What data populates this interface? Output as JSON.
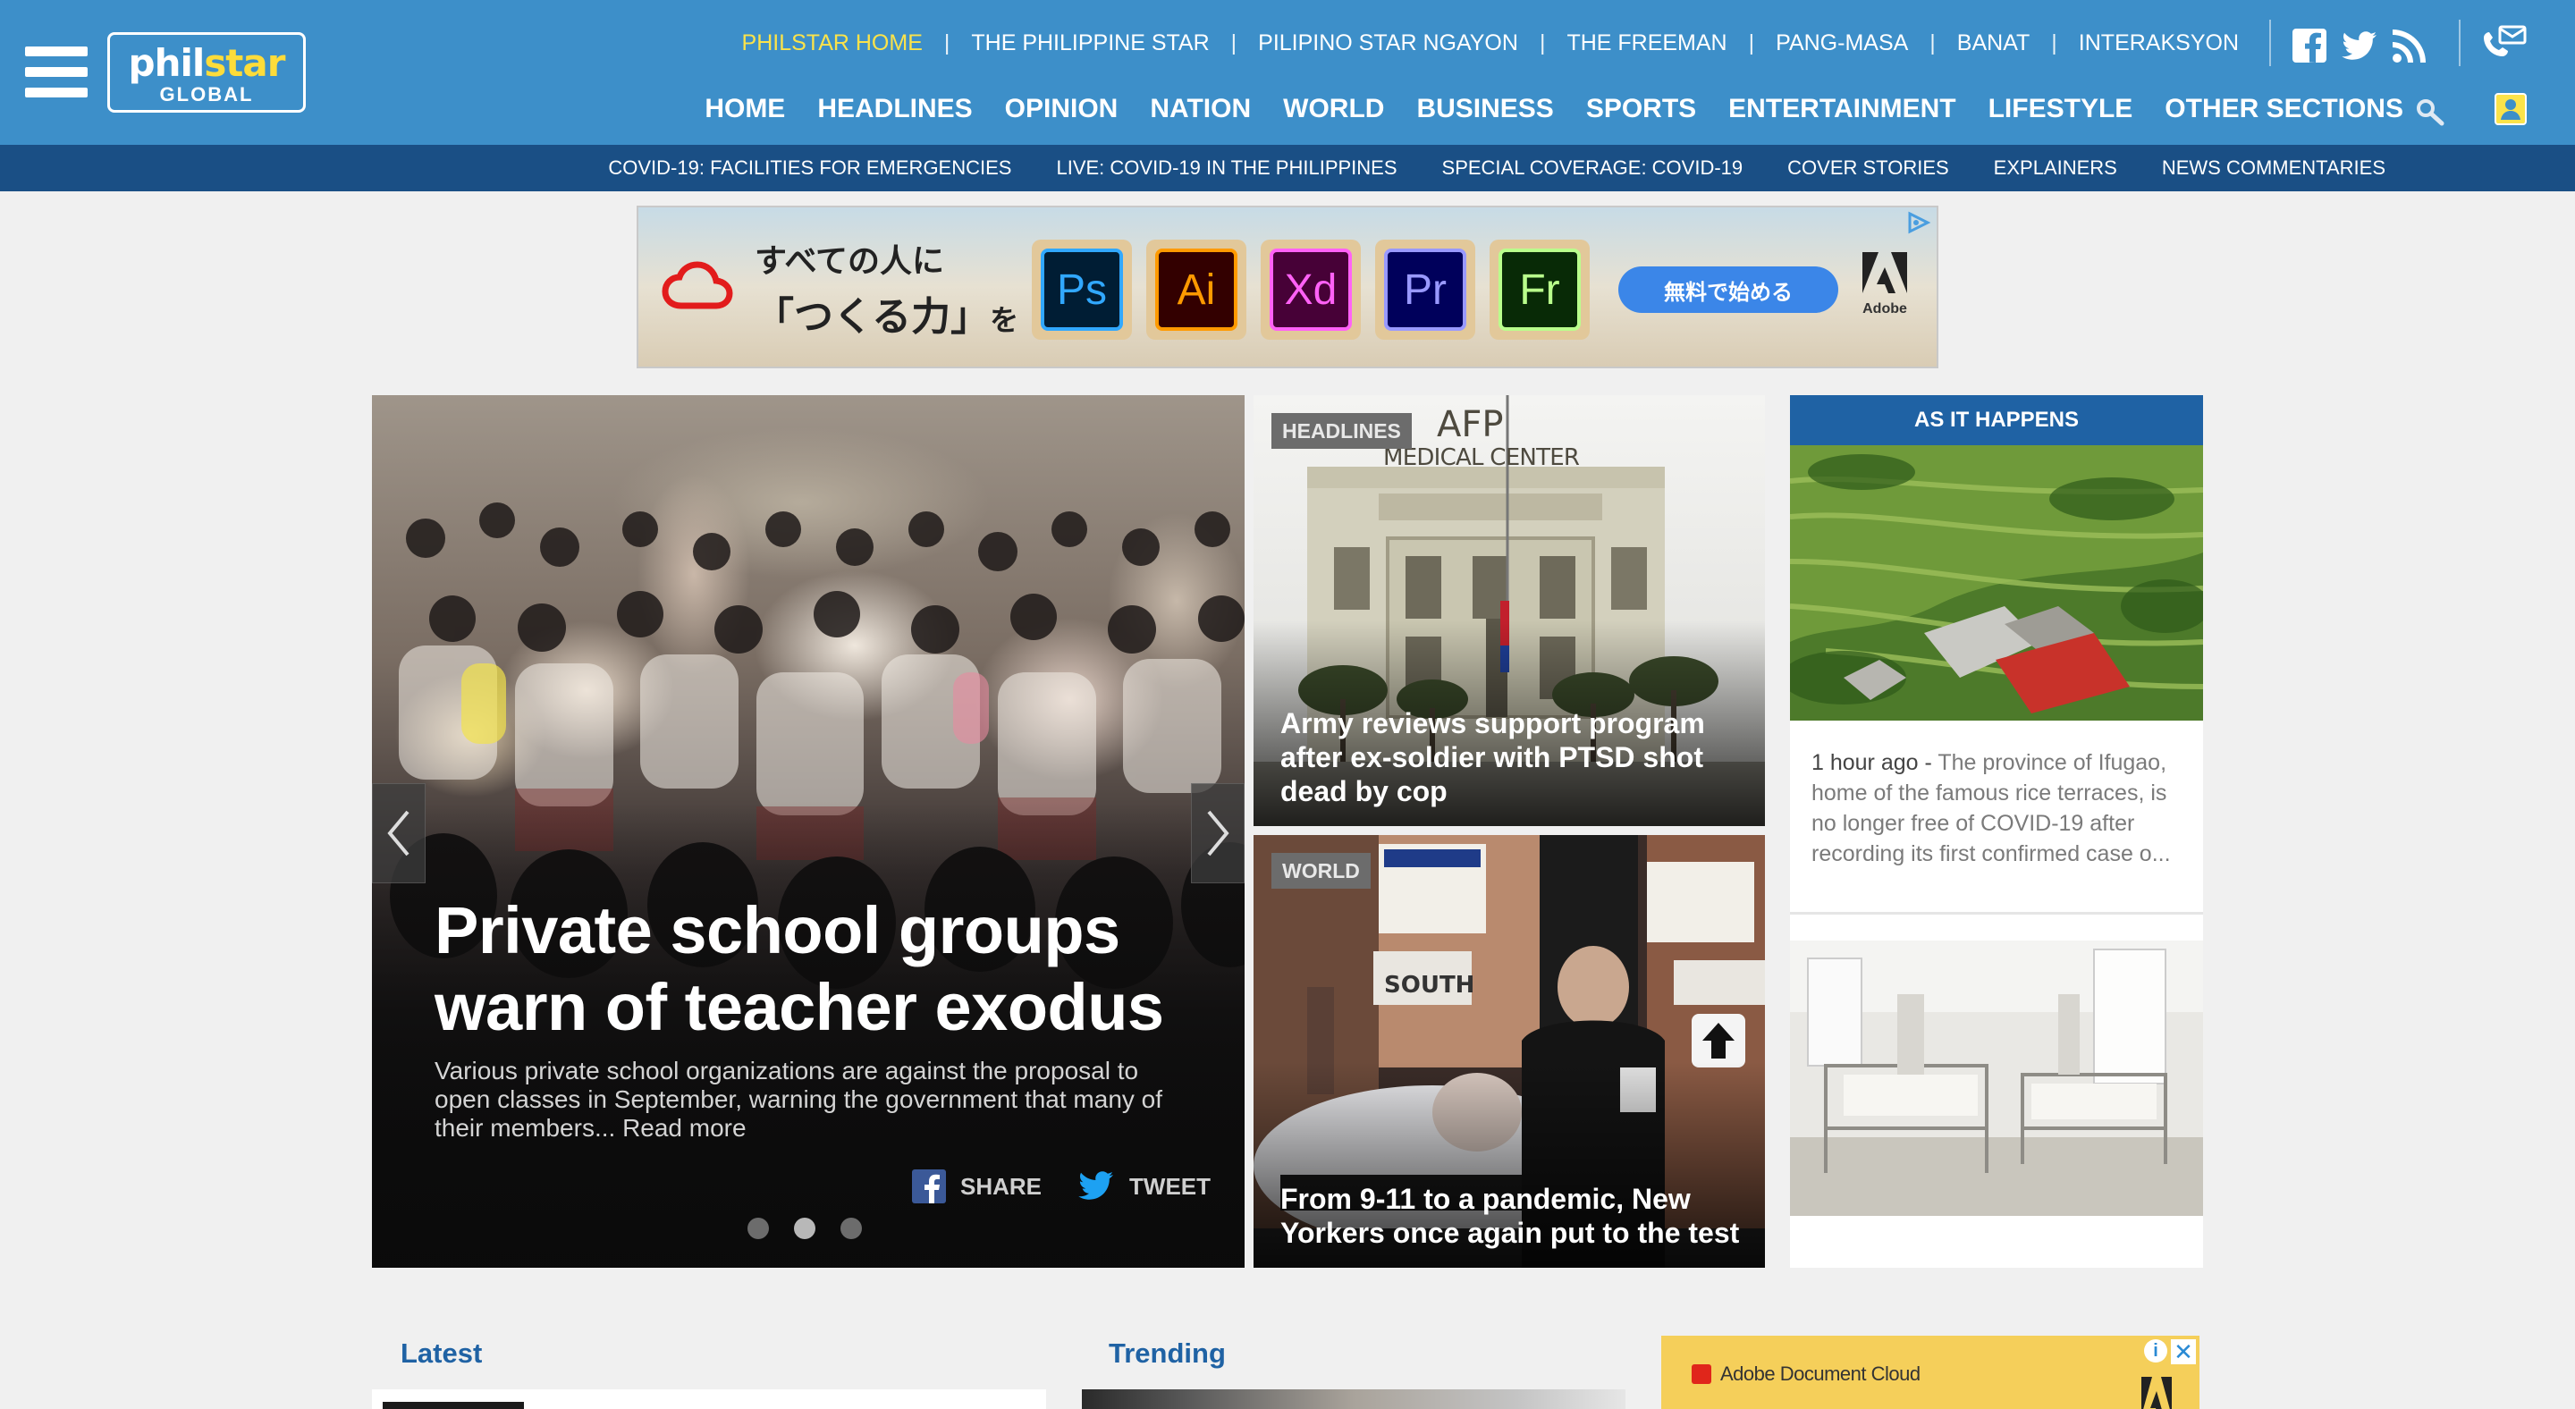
{
  "brand": {
    "logo_top": "philstar",
    "logo_top_a": "phil",
    "logo_top_b": "star",
    "logo_bottom": "GLOBAL"
  },
  "site_links": [
    "PHILSTAR HOME",
    "THE PHILIPPINE STAR",
    "PILIPINO STAR NGAYON",
    "THE FREEMAN",
    "PANG-MASA",
    "BANAT",
    "INTERAKSYON"
  ],
  "site_link_separator": "|",
  "social_icons": [
    "facebook-icon",
    "twitter-icon",
    "rss-icon",
    "contact-icon"
  ],
  "main_nav": [
    "HOME",
    "HEADLINES",
    "OPINION",
    "NATION",
    "WORLD",
    "BUSINESS",
    "SPORTS",
    "ENTERTAINMENT",
    "LIFESTYLE",
    "OTHER SECTIONS"
  ],
  "sub_nav": [
    "COVID-19: FACILITIES FOR EMERGENCIES",
    "LIVE: COVID-19 IN THE PHILIPPINES",
    "SPECIAL COVERAGE: COVID-19",
    "COVER STORIES",
    "EXPLAINERS",
    "NEWS COMMENTARIES"
  ],
  "ad_banner": {
    "line1": "すべての人に",
    "line2_main": "「つくる力」",
    "line2_small": "を",
    "apps": [
      {
        "label": "Ps",
        "bg": "#001d34",
        "fg": "#31a8ff"
      },
      {
        "label": "Ai",
        "bg": "#330000",
        "fg": "#ff9a00"
      },
      {
        "label": "Xd",
        "bg": "#470137",
        "fg": "#ff61f6"
      },
      {
        "label": "Pr",
        "bg": "#00005b",
        "fg": "#9999ff"
      },
      {
        "label": "Fr",
        "bg": "#082a06",
        "fg": "#b9ff8c"
      }
    ],
    "cta": "無料で始める",
    "brand": "Adobe"
  },
  "hero": {
    "title": "Private school groups warn of teacher exodus",
    "excerpt": "Various private school organizations are against the proposal to open classes in September, warning the government that many of their members...",
    "read_more": "Read more",
    "share_label": "SHARE",
    "tweet_label": "TWEET",
    "slides": 3,
    "active_slide": 2
  },
  "stories": [
    {
      "tag": "HEADLINES",
      "title": "Army reviews support program after ex-soldier with PTSD shot dead by cop",
      "sign_top": "AFP",
      "sign_bottom": "MEDICAL CENTER"
    },
    {
      "tag": "WORLD",
      "title": "From 9-11 to a pandemic, New Yorkers once again put to the test",
      "sign": "SOUTH"
    }
  ],
  "as_it_happens": {
    "header": "AS IT HAPPENS",
    "time": "1 hour ago",
    "sep": " - ",
    "text": "The province of Ifugao, home of the famous rice terraces, is no longer free of COVID-19 after recording its first confirmed case o..."
  },
  "sections": {
    "latest": "Latest",
    "trending": "Trending"
  },
  "ad2": {
    "brand_text": "Adobe Document Cloud",
    "info": "i",
    "close": "✕"
  },
  "colors": {
    "header_blue": "#3d8fc9",
    "subnav_blue": "#1a4f85",
    "accent_yellow": "#fbe34a",
    "section_blue": "#1f62a4"
  }
}
